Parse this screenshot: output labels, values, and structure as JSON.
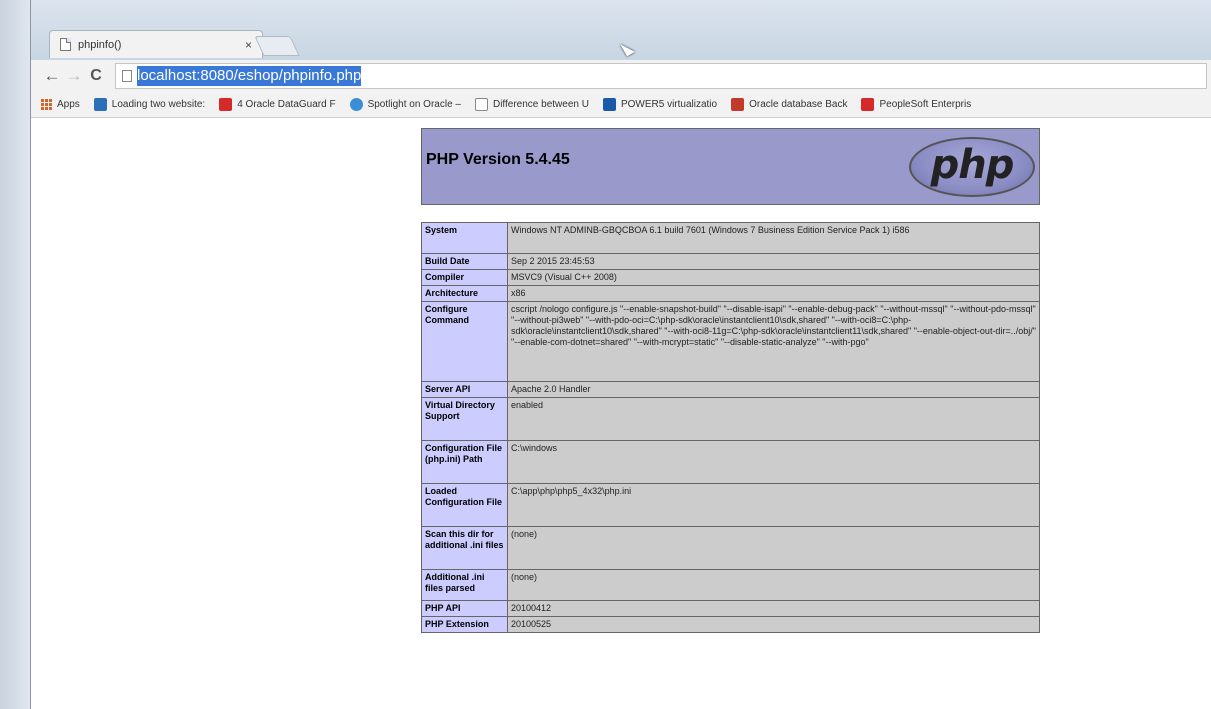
{
  "browser": {
    "tab": {
      "title": "phpinfo()",
      "close": "×"
    },
    "nav": {
      "back": "←",
      "forward": "→",
      "reload": "C"
    },
    "url": "localhost:8080/eshop/phpinfo.php",
    "bookmarks": [
      {
        "label": "Apps",
        "color": "#d2662a"
      },
      {
        "label": "Loading two website:",
        "color": "#2b6fb8"
      },
      {
        "label": "4 Oracle DataGuard F",
        "color": "#d42a2a"
      },
      {
        "label": "Spotlight on Oracle –",
        "color": "#3a8ed6"
      },
      {
        "label": "Difference between U",
        "color": "#ffffff"
      },
      {
        "label": "POWER5 virtualizatio",
        "color": "#1a5aa8"
      },
      {
        "label": "Oracle database Back",
        "color": "#c23b2a"
      },
      {
        "label": "PeopleSoft Enterpris",
        "color": "#d42a2a"
      }
    ]
  },
  "php": {
    "version_title": "PHP Version 5.4.45",
    "logo_text": "php",
    "rows": [
      {
        "key": "System",
        "value": "Windows NT ADMINB-GBQCBOA 6.1 build 7601 (Windows 7 Business Edition Service Pack 1) i586"
      },
      {
        "key": "Build Date",
        "value": "Sep 2 2015 23:45:53"
      },
      {
        "key": "Compiler",
        "value": "MSVC9 (Visual C++ 2008)"
      },
      {
        "key": "Architecture",
        "value": "x86"
      },
      {
        "key": "Configure Command",
        "value": "cscript /nologo configure.js \"--enable-snapshot-build\" \"--disable-isapi\" \"--enable-debug-pack\" \"--without-mssql\" \"--without-pdo-mssql\" \"--without-pi3web\" \"--with-pdo-oci=C:\\php-sdk\\oracle\\instantclient10\\sdk,shared\" \"--with-oci8=C:\\php-sdk\\oracle\\instantclient10\\sdk,shared\" \"--with-oci8-11g=C:\\php-sdk\\oracle\\instantclient11\\sdk,shared\" \"--enable-object-out-dir=../obj/\" \"--enable-com-dotnet=shared\" \"--with-mcrypt=static\" \"--disable-static-analyze\" \"--with-pgo\""
      },
      {
        "key": "Server API",
        "value": "Apache 2.0 Handler"
      },
      {
        "key": "Virtual Directory Support",
        "value": "enabled"
      },
      {
        "key": "Configuration File (php.ini) Path",
        "value": "C:\\windows"
      },
      {
        "key": "Loaded Configuration File",
        "value": "C:\\app\\php\\php5_4x32\\php.ini"
      },
      {
        "key": "Scan this dir for additional .ini files",
        "value": "(none)"
      },
      {
        "key": "Additional .ini files parsed",
        "value": "(none)"
      },
      {
        "key": "PHP API",
        "value": "20100412"
      },
      {
        "key": "PHP Extension",
        "value": "20100525"
      }
    ]
  }
}
